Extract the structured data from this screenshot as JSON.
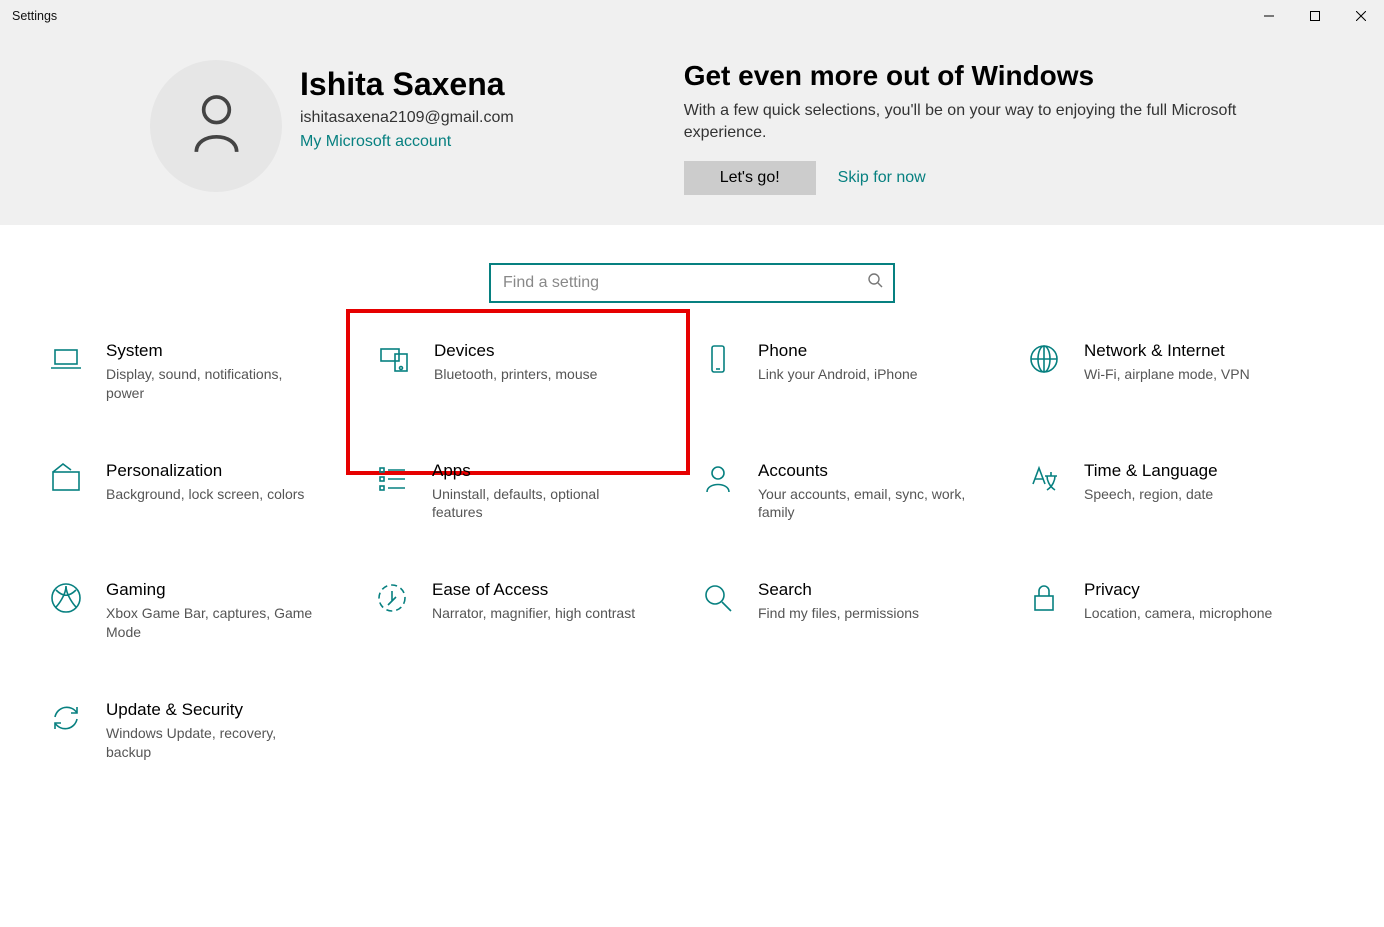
{
  "window": {
    "title": "Settings"
  },
  "user": {
    "name": "Ishita Saxena",
    "email": "ishitasaxena2109@gmail.com",
    "account_link": "My Microsoft account"
  },
  "promo": {
    "title": "Get even more out of Windows",
    "subtitle": "With a few quick selections, you'll be on your way to enjoying the full Microsoft experience.",
    "go_label": "Let's go!",
    "skip_label": "Skip for now"
  },
  "search": {
    "placeholder": "Find a setting"
  },
  "tiles": {
    "system": {
      "title": "System",
      "sub": "Display, sound, notifications, power"
    },
    "devices": {
      "title": "Devices",
      "sub": "Bluetooth, printers, mouse"
    },
    "phone": {
      "title": "Phone",
      "sub": "Link your Android, iPhone"
    },
    "network": {
      "title": "Network & Internet",
      "sub": "Wi-Fi, airplane mode, VPN"
    },
    "personalization": {
      "title": "Personalization",
      "sub": "Background, lock screen, colors"
    },
    "apps": {
      "title": "Apps",
      "sub": "Uninstall, defaults, optional features"
    },
    "accounts": {
      "title": "Accounts",
      "sub": "Your accounts, email, sync, work, family"
    },
    "time": {
      "title": "Time & Language",
      "sub": "Speech, region, date"
    },
    "gaming": {
      "title": "Gaming",
      "sub": "Xbox Game Bar, captures, Game Mode"
    },
    "ease": {
      "title": "Ease of Access",
      "sub": "Narrator, magnifier, high contrast"
    },
    "search_tile": {
      "title": "Search",
      "sub": "Find my files, permissions"
    },
    "privacy": {
      "title": "Privacy",
      "sub": "Location, camera, microphone"
    },
    "update": {
      "title": "Update & Security",
      "sub": "Windows Update, recovery, backup"
    }
  },
  "colors": {
    "accent": "#078080",
    "highlight_border": "#e60000"
  }
}
